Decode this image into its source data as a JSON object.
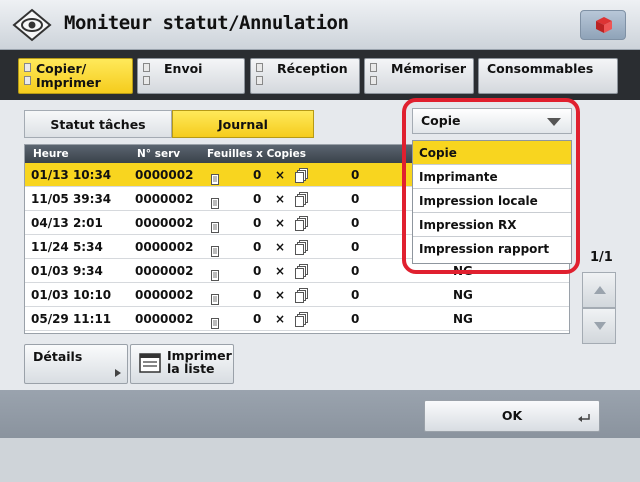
{
  "window": {
    "title": "Moniteur statut/Annulation"
  },
  "tabs": [
    {
      "line1": "Copier/",
      "line2": "Imprimer",
      "active": true
    },
    {
      "line1": "Envoi",
      "line2": "",
      "active": false
    },
    {
      "line1": "Réception",
      "line2": "",
      "active": false
    },
    {
      "line1": "Mémoriser",
      "line2": "",
      "active": false
    },
    {
      "line1": "Consommables",
      "line2": "",
      "active": false
    }
  ],
  "subtabs": {
    "status": "Statut tâches",
    "journal": "Journal"
  },
  "table": {
    "headers": {
      "time": "Heure",
      "number": "N° serv",
      "sheets": "Feuilles x Copies"
    },
    "rows": [
      {
        "time": "01/13 10:34",
        "number": "0000002",
        "sheets": "0",
        "copies": "0",
        "result": "",
        "selected": true
      },
      {
        "time": "11/05 39:34",
        "number": "0000002",
        "sheets": "0",
        "copies": "0",
        "result": ""
      },
      {
        "time": "04/13 2:01",
        "number": "0000002",
        "sheets": "0",
        "copies": "0",
        "result": ""
      },
      {
        "time": "11/24 5:34",
        "number": "0000002",
        "sheets": "0",
        "copies": "0",
        "result": ""
      },
      {
        "time": "01/03 9:34",
        "number": "0000002",
        "sheets": "0",
        "copies": "0",
        "result": "NG"
      },
      {
        "time": "01/03 10:10",
        "number": "0000002",
        "sheets": "0",
        "copies": "0",
        "result": "NG"
      },
      {
        "time": "05/29 11:11",
        "number": "0000002",
        "sheets": "0",
        "copies": "0",
        "result": "NG"
      }
    ],
    "multiply": "×"
  },
  "dropdown": {
    "selected": "Copie",
    "options": [
      "Copie",
      "Imprimante",
      "Impression locale",
      "Impression RX",
      "Impression rapport"
    ]
  },
  "pager": {
    "label": "1/1"
  },
  "buttons": {
    "details": "Détails",
    "print_line1": "Imprimer",
    "print_line2": "la liste",
    "ok": "OK"
  },
  "colors": {
    "accent": "#f8d51f",
    "highlight": "#e0202f"
  }
}
